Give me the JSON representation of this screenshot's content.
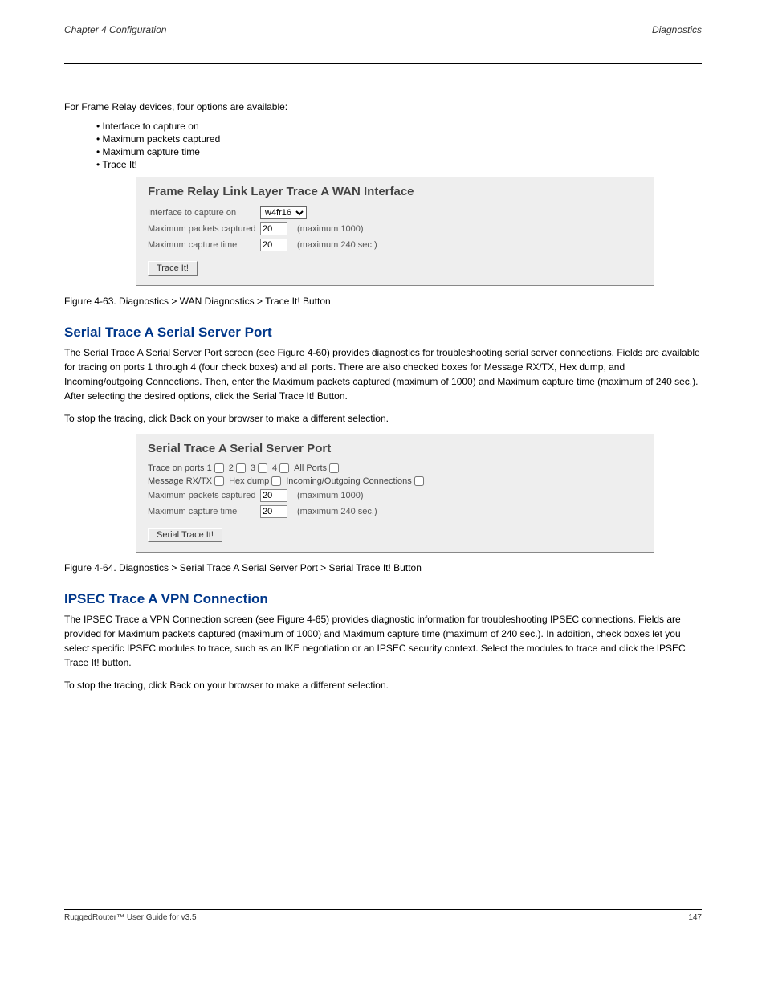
{
  "header": {
    "left": "Chapter 4    Configuration",
    "right": "Diagnostics"
  },
  "intro": "For Frame Relay devices, four options are available:",
  "bullets": [
    "Interface to capture on",
    "Maximum packets captured",
    "Maximum capture time",
    "Trace It!"
  ],
  "panel1": {
    "title": "Frame Relay Link Layer Trace A WAN Interface",
    "interface_label": "Interface to capture on",
    "interface_value": "w4fr16",
    "max_pkts_label": "Maximum packets captured",
    "max_pkts_value": "20",
    "max_pkts_hint": "(maximum 1000)",
    "max_time_label": "Maximum capture time",
    "max_time_value": "20",
    "max_time_hint": "(maximum 240 sec.)",
    "button": "Trace It!"
  },
  "fig1": "Figure 4-63. Diagnostics > WAN Diagnostics > Trace It! Button",
  "section2": {
    "heading": "Serial Trace A Serial Server Port",
    "p1": "The Serial Trace A Serial Server Port screen (see Figure 4-60) provides diagnostics for troubleshooting serial server connections. Fields are available for tracing on ports 1 through 4 (four check boxes) and all ports. There are also checked boxes for Message RX/TX, Hex dump, and Incoming/outgoing Connections. Then, enter the Maximum packets captured (maximum of 1000) and Maximum capture time (maximum of 240 sec.). After selecting the desired options, click the Serial Trace It! Button.",
    "p2": "To stop the tracing, click Back on your browser to make a different selection."
  },
  "panel2": {
    "title": "Serial Trace A Serial Server Port",
    "ports_label": "Trace on ports 1",
    "port_labels": [
      "2",
      "3",
      "4",
      "All Ports"
    ],
    "msg_label": "Message RX/TX",
    "hex_label": "Hex dump",
    "conn_label": "Incoming/Outgoing Connections",
    "max_pkts_label": "Maximum packets captured",
    "max_pkts_value": "20",
    "max_pkts_hint": "(maximum 1000)",
    "max_time_label": "Maximum capture time",
    "max_time_value": "20",
    "max_time_hint": "(maximum 240 sec.)",
    "button": "Serial Trace It!"
  },
  "fig2": "Figure 4-64. Diagnostics > Serial Trace A Serial Server Port > Serial Trace It! Button",
  "section3": {
    "heading": "IPSEC Trace A VPN Connection",
    "p1": "The IPSEC Trace a VPN Connection screen (see Figure 4-65) provides diagnostic information for troubleshooting IPSEC connections. Fields are provided for Maximum packets captured (maximum of 1000) and Maximum capture time (maximum of 240 sec.). In addition, check boxes let you select specific IPSEC modules to trace, such as an IKE negotiation or an IPSEC security context. Select the modules to trace and click the IPSEC Trace It! button.",
    "p2": "To stop the tracing, click Back on your browser to make a different selection."
  },
  "footer": {
    "left": "RuggedRouter™ User Guide for v3.5",
    "right": "147"
  }
}
